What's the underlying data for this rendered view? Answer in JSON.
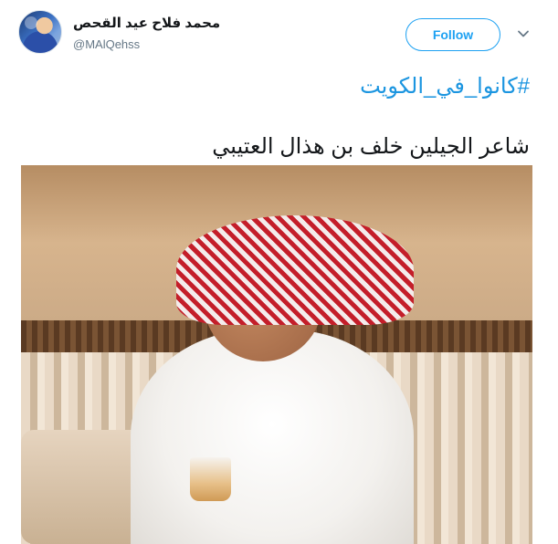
{
  "tweet": {
    "author": {
      "display_name": "محمد فلاح عيد القحص",
      "handle": "@MAlQehss",
      "avatar_icon": "user-avatar-icon"
    },
    "actions": {
      "follow_label": "Follow",
      "menu_icon": "chevron-down-icon"
    },
    "hashtag": "#كانوا_في_الكويت",
    "text": "شاعر الجيلين خلف بن هذال العتيبي",
    "media": {
      "type": "photo",
      "alt": ""
    }
  },
  "colors": {
    "accent": "#1da1f2",
    "link": "#1b95e0",
    "text": "#14171a",
    "secondary_text": "#657786"
  }
}
